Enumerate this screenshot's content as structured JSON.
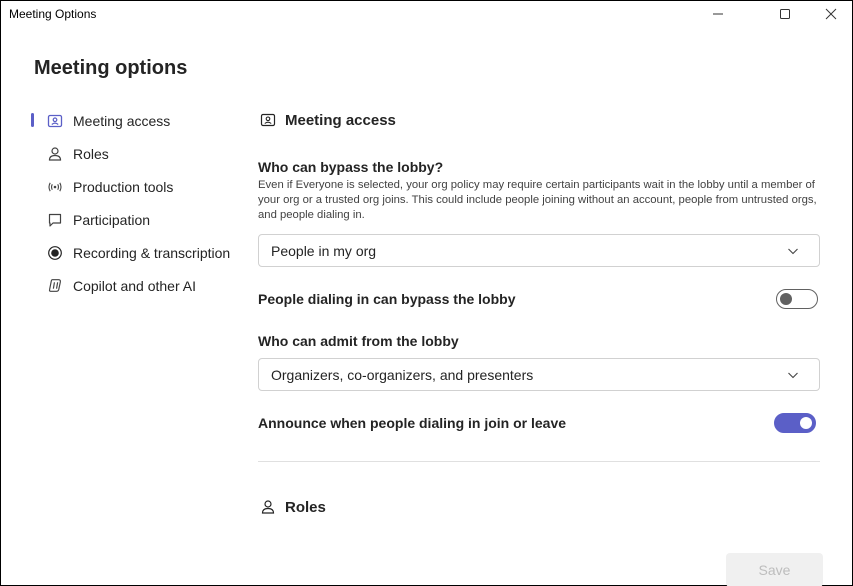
{
  "window": {
    "title": "Meeting Options",
    "controls": {
      "minimize": "–",
      "maximize": "☐",
      "close": "✕"
    }
  },
  "page": {
    "title": "Meeting options"
  },
  "sidebar": {
    "items": [
      {
        "label": "Meeting access",
        "icon": "person-card-icon",
        "active": true
      },
      {
        "label": "Roles",
        "icon": "person-icon",
        "active": false
      },
      {
        "label": "Production tools",
        "icon": "broadcast-icon",
        "active": false
      },
      {
        "label": "Participation",
        "icon": "chat-icon",
        "active": false
      },
      {
        "label": "Recording & transcription",
        "icon": "record-icon",
        "active": false
      },
      {
        "label": "Copilot and other AI",
        "icon": "copilot-icon",
        "active": false
      }
    ]
  },
  "main": {
    "meeting_access": {
      "heading": "Meeting access",
      "bypass": {
        "question": "Who can bypass the lobby?",
        "description": "Even if Everyone is selected, your org policy may require certain participants wait in the lobby until a member of your org or a trusted org joins. This could include people joining without an account, people from untrusted orgs, and people dialing in.",
        "selected": "People in my org"
      },
      "dialin_bypass": {
        "label": "People dialing in can bypass the lobby",
        "on": false
      },
      "admit": {
        "question": "Who can admit from the lobby",
        "selected": "Organizers, co-organizers, and presenters"
      },
      "announce": {
        "label": "Announce when people dialing in join or leave",
        "on": true
      }
    },
    "roles": {
      "heading": "Roles"
    }
  },
  "footer": {
    "save_label": "Save"
  },
  "colors": {
    "accent": "#5b5fc7",
    "text": "#242424",
    "border": "#d1d1d1"
  }
}
